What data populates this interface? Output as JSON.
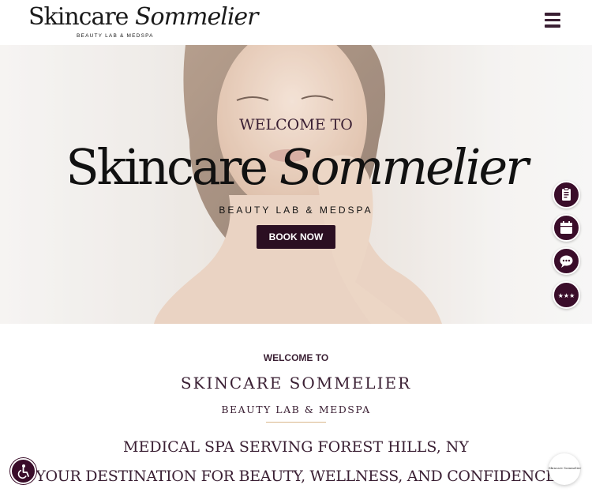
{
  "header": {
    "logo_main_upright": "Skincare ",
    "logo_main_italic": "Sommelier",
    "logo_sub": "BEAUTY LAB & MEDSPA",
    "menu_icon": "hamburger-menu-icon"
  },
  "hero": {
    "welcome": "WELCOME TO",
    "title_upright": "Skincare ",
    "title_italic": "Sommelier",
    "subtitle": "BEAUTY LAB & MEDSPA",
    "book_label": "BOOK NOW"
  },
  "side_buttons": [
    {
      "icon": "clipboard-icon"
    },
    {
      "icon": "calendar-icon"
    },
    {
      "icon": "chat-bubble-icon"
    },
    {
      "icon": "stars-icon"
    }
  ],
  "intro": {
    "welcome": "WELCOME TO",
    "title": "SKINCARE SOMMELIER",
    "subtitle": "BEAUTY LAB & MEDSPA",
    "heading_1": "MEDICAL SPA SERVING FOREST HILLS, NY",
    "heading_2": "YOUR DESTINATION FOR BEAUTY, WELLNESS, AND CONFIDENCE"
  },
  "widgets": {
    "accessibility_icon": "accessibility-icon",
    "chat_widget_text": "Skincare Sommelier"
  },
  "colors": {
    "brand_plum": "#3a0d2a",
    "button_dark": "#2b0f22",
    "accent_gold": "#d9b88c"
  }
}
